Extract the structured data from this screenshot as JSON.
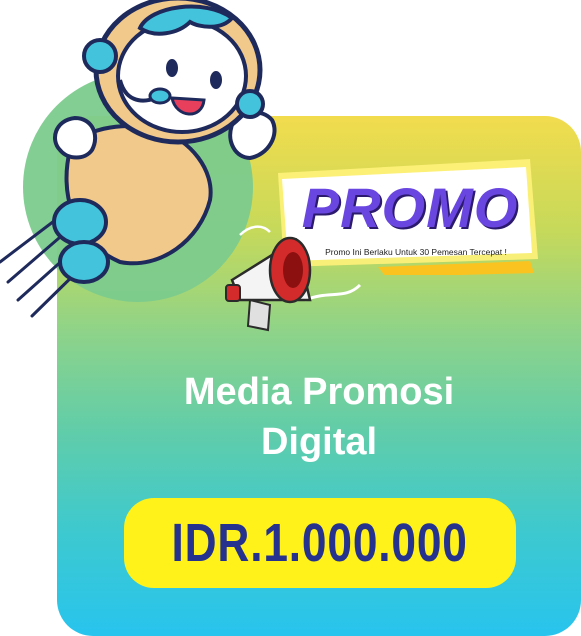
{
  "promo": {
    "headline": "PROMO",
    "subtext": "Promo Ini Berlaku Untuk 30 Pemesan Tercepat !"
  },
  "product": {
    "title_line1": "Media Promosi",
    "title_line2": "Digital"
  },
  "price": {
    "label": "IDR.1.000.000"
  },
  "colors": {
    "price_pill": "#fef21a",
    "price_text": "#26338e",
    "promo_text": "#6a46e0",
    "title_text": "#ffffff"
  },
  "icons": {
    "mascot": "astronaut-mascot-illustration",
    "megaphone": "megaphone-icon"
  }
}
